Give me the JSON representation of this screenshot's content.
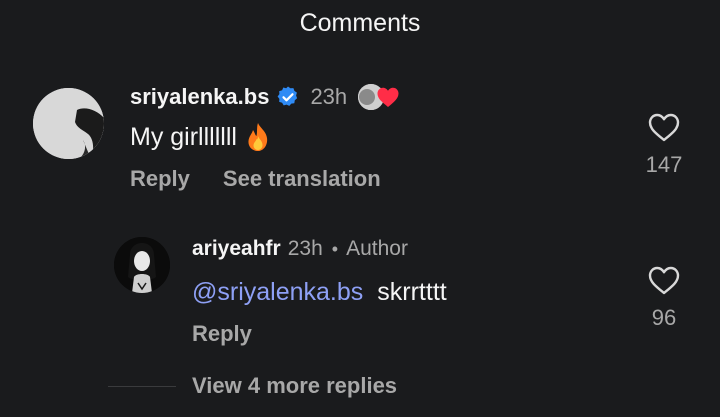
{
  "header": {
    "title": "Comments"
  },
  "comments": [
    {
      "username": "sriyalenka.bs",
      "verified": true,
      "time": "23h",
      "liked_by_author": true,
      "text": "My girlllllll",
      "emoji": "fire-emoji",
      "reply_label": "Reply",
      "translate_label": "See translation",
      "like_count": "147"
    },
    {
      "username": "ariyeahfr",
      "time": "23h",
      "separator": "•",
      "author_label": "Author",
      "mention": "@sriyalenka.bs",
      "text": "skrrtttt",
      "reply_label": "Reply",
      "like_count": "96"
    }
  ],
  "view_more_replies": "View 4 more replies",
  "colors": {
    "background": "#1a1b1d",
    "secondary_text": "#a8a8a8",
    "mention": "#8ea0f5",
    "verified": "#2f8bf5",
    "heart_red": "#ff2d47",
    "fire": "#ff7a1a"
  }
}
